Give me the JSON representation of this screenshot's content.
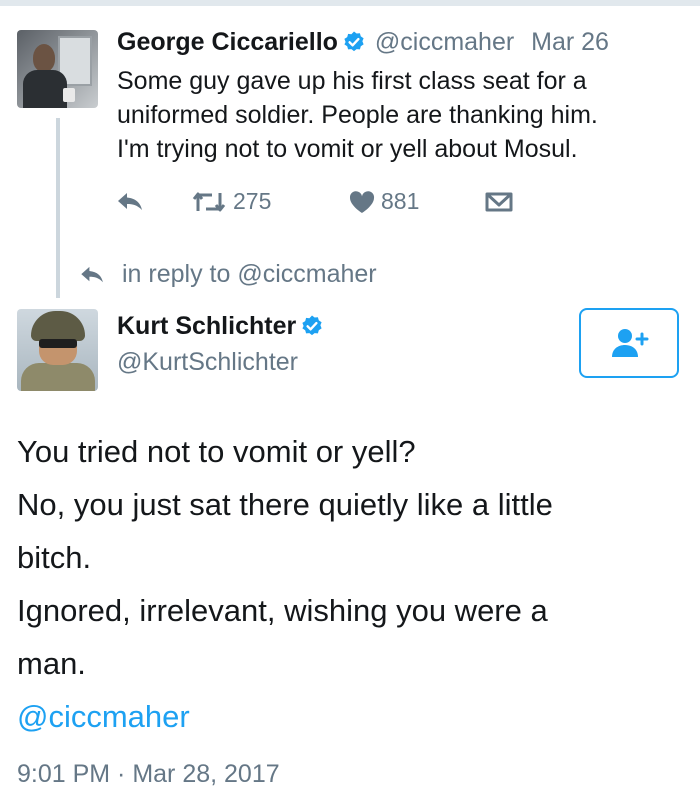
{
  "parent_tweet": {
    "author_name": "George Ciccariello",
    "author_handle": "@ciccmaher",
    "date": "Mar 26",
    "text_lines": [
      "Some guy gave up his first class seat for a",
      "uniformed soldier. People are thanking him.",
      "I'm trying not to vomit or yell about Mosul."
    ],
    "retweet_count": "275",
    "like_count": "881",
    "icons": [
      "reply-icon",
      "retweet-icon",
      "heart-icon",
      "direct-message-icon"
    ]
  },
  "reply_context": {
    "text": "in reply to @ciccmaher"
  },
  "main_tweet": {
    "author_name": "Kurt Schlichter",
    "author_handle": "@KurtSchlichter",
    "follow_icon": "add-user-icon",
    "text_lines": [
      "You tried not to vomit or yell?",
      "No, you just sat there quietly like a little",
      "bitch.",
      "Ignored, irrelevant, wishing you were a",
      "man."
    ],
    "mention": "@ciccmaher",
    "timestamp": "9:01 PM · Mar 28, 2017"
  },
  "colors": {
    "accent": "#1da1f2",
    "muted": "#657786",
    "text": "#14171a",
    "rule": "#e1e8ed"
  }
}
